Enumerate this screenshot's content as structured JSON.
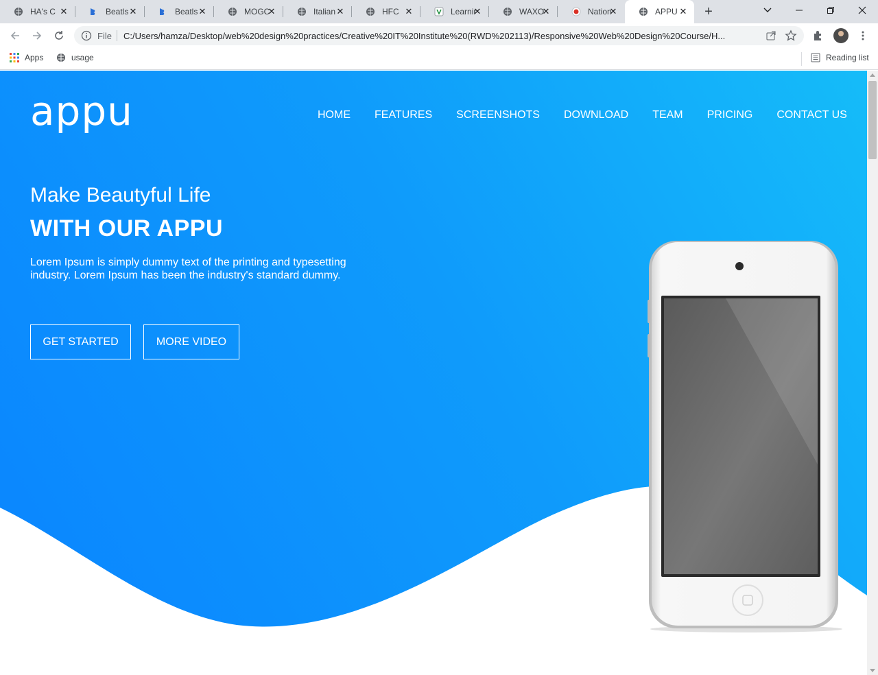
{
  "browser": {
    "tabs": [
      {
        "title": "HA's C",
        "icon": "globe-icon"
      },
      {
        "title": "Beatls",
        "icon": "beatls-icon"
      },
      {
        "title": "Beatls",
        "icon": "beatls-icon"
      },
      {
        "title": "MOGC",
        "icon": "globe-icon"
      },
      {
        "title": "Italian",
        "icon": "globe-icon"
      },
      {
        "title": "HFC",
        "icon": "globe-icon"
      },
      {
        "title": "Learnir",
        "icon": "learning-icon"
      },
      {
        "title": "WAXO",
        "icon": "globe-icon"
      },
      {
        "title": "Nation",
        "icon": "red-dot-icon"
      },
      {
        "title": "APPU",
        "icon": "globe-icon",
        "active": true
      }
    ],
    "address": {
      "scheme_label": "File",
      "url": "C:/Users/hamza/Desktop/web%20design%20practices/Creative%20IT%20Institute%20(RWD%202113)/Responsive%20Web%20Design%20Course/H..."
    },
    "bookmarks": [
      {
        "label": "Apps",
        "icon": "apps-grid-icon"
      },
      {
        "label": "usage",
        "icon": "globe-icon"
      }
    ],
    "reading_list_label": "Reading list"
  },
  "site": {
    "logo_text": "appu",
    "nav": [
      "HOME",
      "FEATURES",
      "SCREENSHOTS",
      "DOWNLOAD",
      "TEAM",
      "PRICING",
      "CONTACT US"
    ],
    "hero": {
      "subtitle": "Make Beautyful Life",
      "title": "WITH OUR APPU",
      "description": "Lorem Ipsum is simply dummy text of the printing and typesetting industry. Lorem Ipsum has been the industry's standard dummy.",
      "primary_button": "GET STARTED",
      "secondary_button": "MORE VIDEO"
    },
    "colors": {
      "gradient_start": "#0a84ff",
      "gradient_end": "#15bcf9",
      "text": "#ffffff"
    }
  }
}
